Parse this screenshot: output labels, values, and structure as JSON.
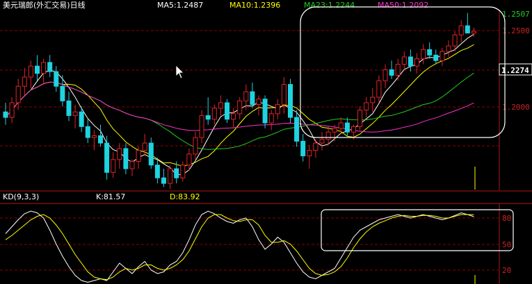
{
  "colors": {
    "background": "#000000",
    "grid": "#8b0000",
    "axis": "#b01818",
    "up": "#e0242a",
    "down": "#1fd3e0",
    "ma5": "#ffffff",
    "ma10": "#ffff00",
    "ma23": "#22cc22",
    "ma50": "#ff33cc",
    "k_line": "#ffffff",
    "d_line": "#ffff00",
    "highlight_box": "#ffffff",
    "cursor": "#ffffff"
  },
  "header": {
    "title": "美元瑞郎(外汇交易)日线",
    "ma5": "MA5:1.2487",
    "ma10": "MA10:1.2396",
    "ma23": "MA23:1.2244",
    "ma50": "MA50:1.2092"
  },
  "price_axis": {
    "ticks": [
      "1.2500",
      "1.2000"
    ],
    "last_high_label": "1.2507",
    "current_label": "1.2274"
  },
  "kd_panel": {
    "title": "KD(9,3,3)",
    "k_label": "K:81.57",
    "d_label": "D:83.92",
    "ticks": [
      "80",
      "50",
      "20"
    ]
  },
  "chart_data": [
    {
      "type": "candlestick",
      "title": "美元瑞郎(外汇交易)日线",
      "ylim": [
        1.165,
        1.262
      ],
      "candles": [
        [
          1.207,
          1.212,
          1.2,
          1.204
        ],
        [
          1.204,
          1.215,
          1.201,
          1.212
        ],
        [
          1.212,
          1.225,
          1.208,
          1.221
        ],
        [
          1.221,
          1.231,
          1.216,
          1.226
        ],
        [
          1.226,
          1.235,
          1.22,
          1.232
        ],
        [
          1.232,
          1.238,
          1.224,
          1.228
        ],
        [
          1.228,
          1.236,
          1.222,
          1.234
        ],
        [
          1.234,
          1.238,
          1.226,
          1.229
        ],
        [
          1.229,
          1.232,
          1.218,
          1.221
        ],
        [
          1.221,
          1.227,
          1.21,
          1.213
        ],
        [
          1.213,
          1.218,
          1.202,
          1.205
        ],
        [
          1.205,
          1.211,
          1.198,
          1.207
        ],
        [
          1.207,
          1.21,
          1.196,
          1.199
        ],
        [
          1.199,
          1.203,
          1.19,
          1.193
        ],
        [
          1.193,
          1.197,
          1.186,
          1.194
        ],
        [
          1.194,
          1.2,
          1.188,
          1.19
        ],
        [
          1.19,
          1.194,
          1.17,
          1.174
        ],
        [
          1.174,
          1.185,
          1.171,
          1.181
        ],
        [
          1.181,
          1.19,
          1.176,
          1.187
        ],
        [
          1.187,
          1.19,
          1.173,
          1.176
        ],
        [
          1.176,
          1.181,
          1.172,
          1.18
        ],
        [
          1.18,
          1.188,
          1.176,
          1.186
        ],
        [
          1.186,
          1.195,
          1.183,
          1.19
        ],
        [
          1.19,
          1.193,
          1.176,
          1.178
        ],
        [
          1.178,
          1.182,
          1.168,
          1.171
        ],
        [
          1.171,
          1.176,
          1.166,
          1.168
        ],
        [
          1.168,
          1.178,
          1.165,
          1.176
        ],
        [
          1.176,
          1.18,
          1.168,
          1.171
        ],
        [
          1.171,
          1.18,
          1.169,
          1.178
        ],
        [
          1.178,
          1.187,
          1.175,
          1.184
        ],
        [
          1.184,
          1.196,
          1.181,
          1.193
        ],
        [
          1.193,
          1.208,
          1.19,
          1.205
        ],
        [
          1.205,
          1.215,
          1.2,
          1.203
        ],
        [
          1.203,
          1.211,
          1.2,
          1.209
        ],
        [
          1.209,
          1.216,
          1.205,
          1.212
        ],
        [
          1.212,
          1.214,
          1.201,
          1.203
        ],
        [
          1.203,
          1.209,
          1.198,
          1.206
        ],
        [
          1.206,
          1.215,
          1.203,
          1.213
        ],
        [
          1.213,
          1.222,
          1.208,
          1.218
        ],
        [
          1.218,
          1.223,
          1.209,
          1.211
        ],
        [
          1.211,
          1.216,
          1.205,
          1.214
        ],
        [
          1.214,
          1.216,
          1.198,
          1.201
        ],
        [
          1.201,
          1.208,
          1.197,
          1.206
        ],
        [
          1.206,
          1.214,
          1.203,
          1.211
        ],
        [
          1.211,
          1.226,
          1.206,
          1.222
        ],
        [
          1.222,
          1.225,
          1.201,
          1.204
        ],
        [
          1.204,
          1.208,
          1.188,
          1.191
        ],
        [
          1.191,
          1.195,
          1.18,
          1.183
        ],
        [
          1.183,
          1.189,
          1.176,
          1.186
        ],
        [
          1.186,
          1.192,
          1.182,
          1.19
        ],
        [
          1.19,
          1.196,
          1.186,
          1.192
        ],
        [
          1.192,
          1.199,
          1.189,
          1.196
        ],
        [
          1.196,
          1.2,
          1.191,
          1.198
        ],
        [
          1.198,
          1.204,
          1.195,
          1.201
        ],
        [
          1.201,
          1.204,
          1.194,
          1.196
        ],
        [
          1.196,
          1.2,
          1.192,
          1.199
        ],
        [
          1.199,
          1.21,
          1.197,
          1.208
        ],
        [
          1.208,
          1.215,
          1.204,
          1.212
        ],
        [
          1.212,
          1.22,
          1.207,
          1.215
        ],
        [
          1.215,
          1.227,
          1.212,
          1.224
        ],
        [
          1.224,
          1.233,
          1.22,
          1.23
        ],
        [
          1.23,
          1.235,
          1.225,
          1.227
        ],
        [
          1.227,
          1.236,
          1.224,
          1.233
        ],
        [
          1.233,
          1.24,
          1.23,
          1.237
        ],
        [
          1.237,
          1.241,
          1.229,
          1.232
        ],
        [
          1.232,
          1.239,
          1.228,
          1.236
        ],
        [
          1.236,
          1.244,
          1.233,
          1.241
        ],
        [
          1.241,
          1.245,
          1.236,
          1.238
        ],
        [
          1.238,
          1.241,
          1.233,
          1.235
        ],
        [
          1.235,
          1.242,
          1.232,
          1.24
        ],
        [
          1.24,
          1.246,
          1.237,
          1.243
        ],
        [
          1.243,
          1.251,
          1.24,
          1.249
        ],
        [
          1.249,
          1.257,
          1.245,
          1.254
        ],
        [
          1.254,
          1.261,
          1.25,
          1.25
        ],
        [
          1.25,
          1.253,
          1.248,
          1.251
        ]
      ],
      "ma_periods": [
        5,
        10,
        23,
        50
      ]
    },
    {
      "type": "line",
      "title": "KD(9,3,3)",
      "ylim": [
        0,
        100
      ],
      "series": [
        {
          "name": "K",
          "values": [
            62,
            70,
            78,
            85,
            88,
            86,
            80,
            66,
            50,
            36,
            24,
            14,
            8,
            6,
            8,
            10,
            8,
            18,
            28,
            22,
            16,
            24,
            30,
            20,
            16,
            18,
            26,
            30,
            40,
            55,
            72,
            84,
            88,
            85,
            80,
            76,
            74,
            78,
            80,
            70,
            55,
            44,
            50,
            58,
            52,
            40,
            28,
            18,
            12,
            10,
            14,
            18,
            22,
            34,
            46,
            58,
            66,
            70,
            74,
            78,
            80,
            82,
            84,
            82,
            80,
            82,
            84,
            82,
            80,
            78,
            80,
            83,
            86,
            84,
            81.57
          ]
        },
        {
          "name": "D",
          "values": [
            55,
            60,
            66,
            72,
            78,
            82,
            84,
            80,
            72,
            62,
            50,
            38,
            28,
            18,
            12,
            10,
            9,
            12,
            18,
            22,
            20,
            22,
            26,
            26,
            22,
            20,
            22,
            26,
            32,
            42,
            56,
            70,
            80,
            84,
            84,
            80,
            77,
            76,
            78,
            78,
            72,
            60,
            52,
            52,
            54,
            50,
            42,
            32,
            22,
            16,
            14,
            15,
            18,
            24,
            34,
            46,
            56,
            64,
            70,
            74,
            77,
            80,
            82,
            83,
            82,
            82,
            83,
            83,
            82,
            80,
            80,
            82,
            84,
            84,
            83.92
          ]
        }
      ]
    }
  ]
}
